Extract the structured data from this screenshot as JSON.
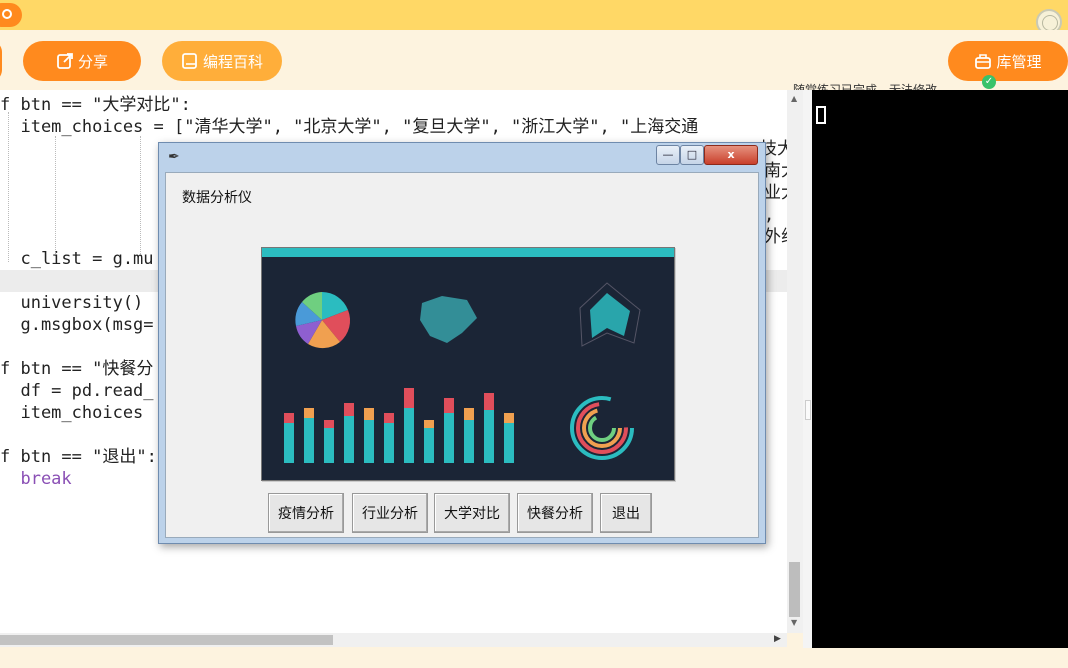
{
  "toolbar": {
    "share_label": "分享",
    "wiki_label": "编程百科",
    "status_text": "随堂练习已完成，无法修改",
    "library_label": "库管理"
  },
  "code": {
    "lines": [
      "f btn == \"大学对比\":",
      "  item_choices = [\"清华大学\", \"北京大学\", \"复旦大学\", \"浙江大学\", \"上海交通",
      "  c_list = g.mu",
      "  university()",
      "  g.msgbox(msg=",
      "f btn == \"快餐分",
      "  df = pd.read_",
      "  item_choices",
      "f btn == \"退出\":",
      "  break"
    ],
    "fragments": [
      "技大",
      "南大",
      "业大",
      ",",
      "外组"
    ]
  },
  "dialog": {
    "heading": "数据分析仪",
    "buttons": [
      "疫情分析",
      "行业分析",
      "大学对比",
      "快餐分析",
      "退出"
    ],
    "close_glyph": "x",
    "min_glyph": "—",
    "max_glyph": "□"
  },
  "colors": {
    "accent_orange": "#ff8a1e",
    "top_yellow": "#ffd866",
    "dashboard_bg": "#1b2536",
    "teal": "#2bbcc0"
  }
}
